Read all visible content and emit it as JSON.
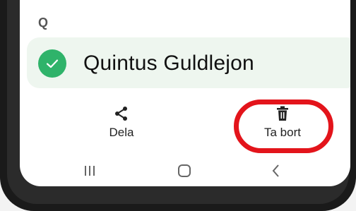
{
  "contacts": {
    "section_letter": "Q",
    "selected_contact": {
      "name": "Quintus Guldlejon",
      "selected": true
    }
  },
  "actions": {
    "share_label": "Dela",
    "delete_label": "Ta bort"
  },
  "navbar": {
    "recent": "recent-apps",
    "home": "home",
    "back": "back"
  },
  "colors": {
    "highlight": "#e3141b",
    "check": "#2fb36a",
    "row_bg": "#eef6ef"
  }
}
